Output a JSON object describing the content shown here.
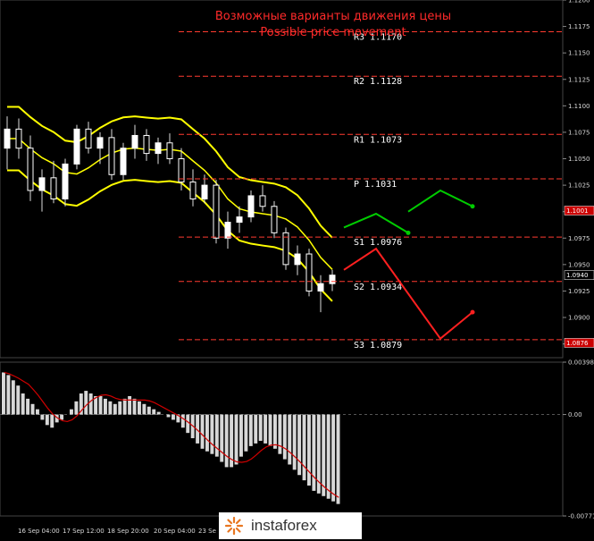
{
  "title_ru": "Возможные варианты движения цены",
  "title_en": "Possible price movement",
  "colors": {
    "background": "#000000",
    "pivot_line": "#ff3b30",
    "bollinger": "#ffff00",
    "title": "#ff2a2a",
    "arrow_up": "#00cc00",
    "arrow_down": "#ff2020",
    "macd_signal": "#d00000",
    "macd_hist": "#d8d8d8"
  },
  "chart_data": [
    {
      "type": "candlestick",
      "title": "Возможные варианты движения цены / Possible price movement",
      "y_ticks": [
        "1.1200",
        "1.1175",
        "1.1150",
        "1.1125",
        "1.1100",
        "1.1075",
        "1.1050",
        "1.1025",
        "1.1000",
        "1.0975",
        "1.0950",
        "1.0925",
        "1.0900",
        "1.0875"
      ],
      "ylim": [
        1.0862,
        1.12
      ],
      "x_ticks": [
        "16 Sep 04:00",
        "17 Sep 12:00",
        "18 Sep 20:00",
        "20 Sep 04:00",
        "23 Se"
      ],
      "pivot_levels": [
        {
          "label": "R3",
          "value": 1.117,
          "text": "R3 1.1170"
        },
        {
          "label": "R2",
          "value": 1.1128,
          "text": "R2 1.1128"
        },
        {
          "label": "R1",
          "value": 1.1073,
          "text": "R1 1.1073"
        },
        {
          "label": "P",
          "value": 1.1031,
          "text": "P 1.1031"
        },
        {
          "label": "S1",
          "value": 1.0976,
          "text": "S1 1.0976"
        },
        {
          "label": "S2",
          "value": 1.0934,
          "text": "S2 1.0934"
        },
        {
          "label": "S3",
          "value": 1.0879,
          "text": "S3 1.0879"
        }
      ],
      "price_badges": [
        {
          "text": "1.1001",
          "value": 1.1001,
          "color": "#cc0000"
        },
        {
          "text": "1.0940",
          "value": 1.094,
          "color": "#000000"
        },
        {
          "text": "1.0876",
          "value": 1.0876,
          "color": "#cc0000"
        }
      ],
      "candles": [
        {
          "o": 1.106,
          "h": 1.109,
          "l": 1.104,
          "c": 1.1078
        },
        {
          "o": 1.1078,
          "h": 1.1088,
          "l": 1.105,
          "c": 1.106
        },
        {
          "o": 1.106,
          "h": 1.1072,
          "l": 1.101,
          "c": 1.102
        },
        {
          "o": 1.102,
          "h": 1.104,
          "l": 1.1,
          "c": 1.1032
        },
        {
          "o": 1.1032,
          "h": 1.1048,
          "l": 1.1008,
          "c": 1.1012
        },
        {
          "o": 1.1012,
          "h": 1.105,
          "l": 1.1005,
          "c": 1.1045
        },
        {
          "o": 1.1045,
          "h": 1.1082,
          "l": 1.104,
          "c": 1.1078
        },
        {
          "o": 1.1078,
          "h": 1.1085,
          "l": 1.1055,
          "c": 1.106
        },
        {
          "o": 1.106,
          "h": 1.1075,
          "l": 1.1045,
          "c": 1.107
        },
        {
          "o": 1.107,
          "h": 1.1078,
          "l": 1.103,
          "c": 1.1035
        },
        {
          "o": 1.1035,
          "h": 1.1065,
          "l": 1.103,
          "c": 1.106
        },
        {
          "o": 1.106,
          "h": 1.1082,
          "l": 1.105,
          "c": 1.1072
        },
        {
          "o": 1.1072,
          "h": 1.1078,
          "l": 1.1048,
          "c": 1.1055
        },
        {
          "o": 1.1055,
          "h": 1.107,
          "l": 1.1045,
          "c": 1.1065
        },
        {
          "o": 1.1065,
          "h": 1.1074,
          "l": 1.1045,
          "c": 1.105
        },
        {
          "o": 1.105,
          "h": 1.106,
          "l": 1.102,
          "c": 1.1028
        },
        {
          "o": 1.1028,
          "h": 1.104,
          "l": 1.1005,
          "c": 1.1012
        },
        {
          "o": 1.1012,
          "h": 1.1035,
          "l": 1.1008,
          "c": 1.1025
        },
        {
          "o": 1.1025,
          "h": 1.103,
          "l": 1.097,
          "c": 1.0975
        },
        {
          "o": 1.0975,
          "h": 1.1,
          "l": 1.0965,
          "c": 1.099
        },
        {
          "o": 1.099,
          "h": 1.1005,
          "l": 1.098,
          "c": 1.0995
        },
        {
          "o": 1.0995,
          "h": 1.102,
          "l": 1.099,
          "c": 1.1015
        },
        {
          "o": 1.1015,
          "h": 1.1025,
          "l": 1.1,
          "c": 1.1005
        },
        {
          "o": 1.1005,
          "h": 1.101,
          "l": 1.0975,
          "c": 1.098
        },
        {
          "o": 1.098,
          "h": 1.0985,
          "l": 1.0945,
          "c": 1.095
        },
        {
          "o": 1.095,
          "h": 1.0968,
          "l": 1.094,
          "c": 1.096
        },
        {
          "o": 1.096,
          "h": 1.0965,
          "l": 1.092,
          "c": 1.0925
        },
        {
          "o": 1.0925,
          "h": 1.094,
          "l": 1.0905,
          "c": 1.0932
        },
        {
          "o": 1.0932,
          "h": 1.0945,
          "l": 1.0925,
          "c": 1.094
        }
      ],
      "forecast_paths": [
        {
          "color": "green",
          "points": [
            [
              1.0985,
              0
            ],
            [
              1.0998,
              1
            ],
            [
              1.098,
              2
            ]
          ]
        },
        {
          "color": "green",
          "points": [
            [
              1.1,
              2
            ],
            [
              1.102,
              3
            ],
            [
              1.1005,
              4
            ]
          ]
        },
        {
          "color": "red",
          "points": [
            [
              1.0945,
              0
            ],
            [
              1.0965,
              1
            ],
            [
              1.088,
              3
            ],
            [
              1.0905,
              4
            ]
          ]
        }
      ]
    },
    {
      "type": "bar",
      "title": "",
      "indicator": "MACD",
      "y_ticks": [
        "0.00398",
        "0.00",
        "-0.00771"
      ],
      "ylim": [
        -0.00771,
        0.00398
      ],
      "values": [
        0.0032,
        0.003,
        0.0026,
        0.0022,
        0.0016,
        0.0012,
        0.0008,
        0.0004,
        -0.0004,
        -0.0008,
        -0.001,
        -0.0006,
        -0.0004,
        0.0,
        0.0004,
        0.001,
        0.0016,
        0.0018,
        0.0016,
        0.0014,
        0.0014,
        0.0012,
        0.001,
        0.0008,
        0.001,
        0.0012,
        0.0014,
        0.0012,
        0.001,
        0.0008,
        0.0006,
        0.0004,
        0.0002,
        0.0,
        -0.0002,
        -0.0004,
        -0.0006,
        -0.001,
        -0.0014,
        -0.0018,
        -0.0022,
        -0.0026,
        -0.0028,
        -0.003,
        -0.0032,
        -0.0036,
        -0.004,
        -0.004,
        -0.0038,
        -0.0032,
        -0.0028,
        -0.0024,
        -0.0022,
        -0.002,
        -0.0022,
        -0.0024,
        -0.0026,
        -0.003,
        -0.0034,
        -0.0038,
        -0.0042,
        -0.0046,
        -0.005,
        -0.0054,
        -0.0058,
        -0.006,
        -0.0062,
        -0.0064,
        -0.0066,
        -0.0068
      ]
    }
  ],
  "watermark": {
    "text": "instaforex"
  }
}
